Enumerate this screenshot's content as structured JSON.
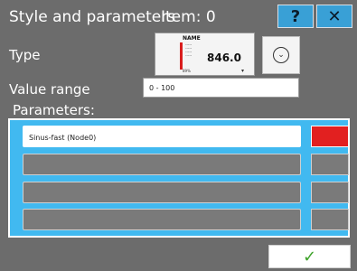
{
  "header": {
    "title": "Style and parameters",
    "item_label": "Item: 0",
    "help_label": "?",
    "close_label": "✕"
  },
  "type": {
    "label": "Type",
    "preview": {
      "name": "NAME",
      "value": "846.0",
      "percent": "89%",
      "indicator_color": "#d91d1d"
    },
    "dropdown_icon": "chevron-down-circle"
  },
  "value_range": {
    "label": "Value range",
    "value": "0 - 100"
  },
  "parameters": {
    "label": "Parameters:",
    "rows": [
      {
        "name": "Sinus-fast (Node0)",
        "color": "#e22020"
      },
      {
        "name": "",
        "color": "#7a7a7a"
      },
      {
        "name": "",
        "color": "#7a7a7a"
      },
      {
        "name": "",
        "color": "#7a7a7a"
      }
    ]
  },
  "footer": {
    "ok_label": "✓"
  },
  "colors": {
    "accent": "#39a0d6",
    "panel_bg": "#6c6c6c",
    "params_bg": "#41b9f0",
    "ok_check": "#3ea32a"
  }
}
